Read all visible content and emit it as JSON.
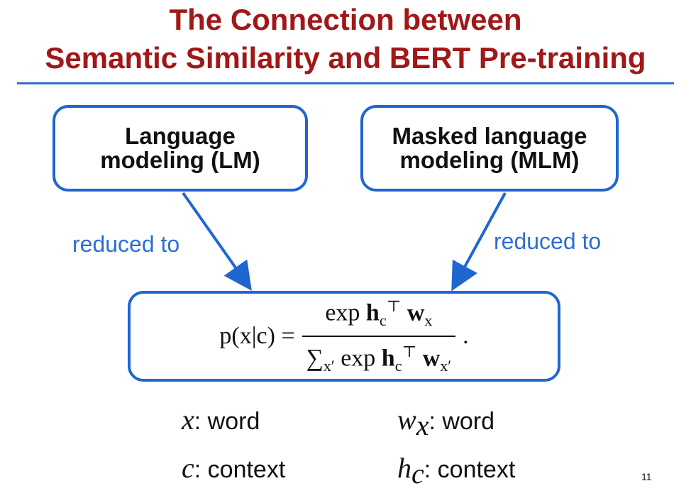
{
  "slide": {
    "title_line1": "The Connection between",
    "title_line2": "Semantic Similarity and BERT Pre-training",
    "page_number": "11"
  },
  "boxes": {
    "lm": {
      "line1": "Language",
      "line2": "modeling (LM)"
    },
    "mlm": {
      "line1": "Masked language",
      "line2": "modeling (MLM)"
    }
  },
  "arrows": {
    "left_label": "reduced to",
    "right_label": "reduced to"
  },
  "equation": {
    "lhs": "p(x|c) =",
    "numerator_exp": "exp",
    "h": "h",
    "c_sub": "c",
    "transpose": "⊤",
    "w": "w",
    "x_sub": "x",
    "sum": "∑",
    "sum_sub": "x′",
    "denominator_exp": "exp",
    "xprime_sub": "x′",
    "period": "."
  },
  "legend": {
    "x_var": "x",
    "x_desc": ": word",
    "c_var": "c",
    "c_desc": ": context",
    "w_var": "w",
    "w_sub": "x",
    "w_desc": ": word",
    "h_var": "h",
    "h_sub": "c",
    "h_desc": ": context"
  },
  "colors": {
    "title": "#a01818",
    "accent_blue": "#1f66d1",
    "label_blue": "#2b6ed3"
  }
}
